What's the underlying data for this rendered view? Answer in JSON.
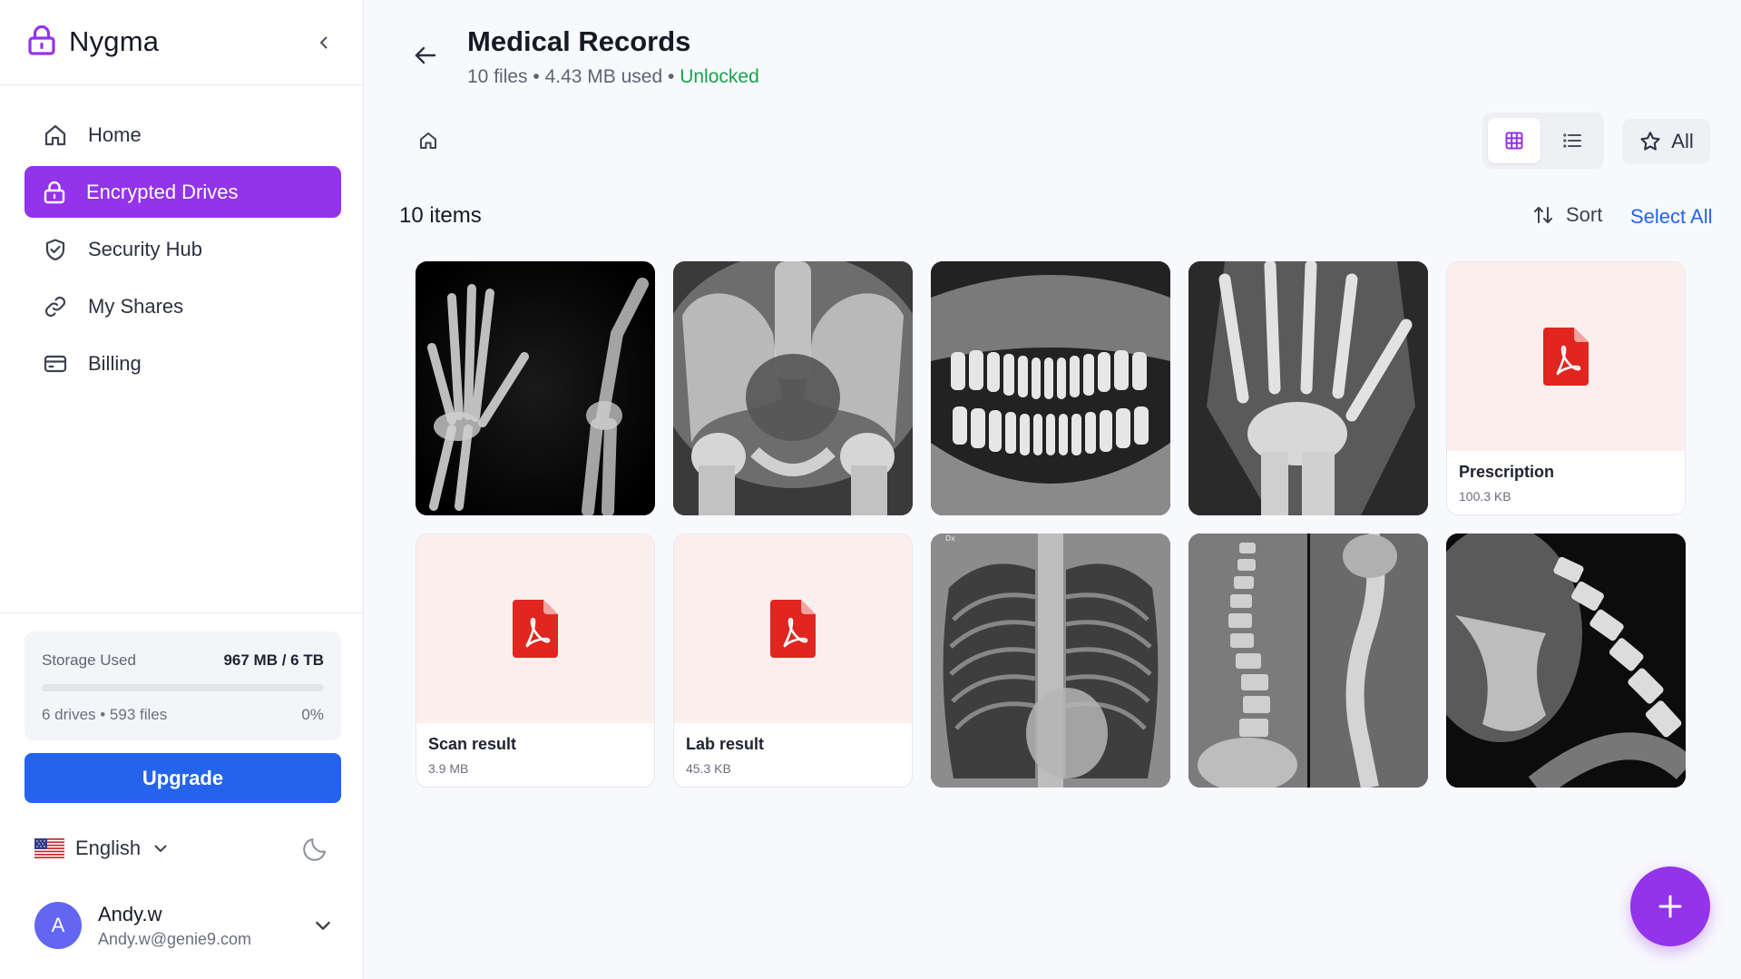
{
  "app": {
    "name": "Nygma",
    "logo_icon": "lock-icon",
    "accent": "#9333ea",
    "link_color": "#2563eb",
    "unlocked_color": "#16a34a"
  },
  "sidebar": {
    "items": [
      {
        "label": "Home",
        "icon": "home-icon",
        "active": false
      },
      {
        "label": "Encrypted Drives",
        "icon": "lock-icon",
        "active": true
      },
      {
        "label": "Security Hub",
        "icon": "shield-check-icon",
        "active": false
      },
      {
        "label": "My Shares",
        "icon": "link-icon",
        "active": false
      },
      {
        "label": "Billing",
        "icon": "credit-card-icon",
        "active": false
      }
    ],
    "storage": {
      "label": "Storage Used",
      "value": "967 MB / 6 TB",
      "meta": "6 drives • 593 files",
      "percent_label": "0%",
      "percent": 0
    },
    "upgrade_label": "Upgrade",
    "language": {
      "label": "English",
      "flag": "us-flag-icon"
    },
    "theme_icon": "moon-icon",
    "user": {
      "initial": "A",
      "name": "Andy.w",
      "email": "Andy.w@genie9.com",
      "avatar_color": "#6366f1"
    }
  },
  "header": {
    "title": "Medical Records",
    "subtitle_files": "10 files",
    "subtitle_used": "4.43 MB used",
    "subtitle_sep": " • ",
    "status": "Unlocked"
  },
  "toolbar": {
    "view": "grid",
    "filter_label": "All",
    "items_count": "10 items",
    "sort_label": "Sort",
    "select_all_label": "Select All"
  },
  "files": [
    {
      "type": "image",
      "name": "hand-xray-pair",
      "caption": ""
    },
    {
      "type": "image",
      "name": "pelvis-xray",
      "caption": ""
    },
    {
      "type": "image",
      "name": "dental-panoramic-xray",
      "caption": ""
    },
    {
      "type": "image",
      "name": "hand-xray",
      "caption": ""
    },
    {
      "type": "pdf",
      "name": "Prescription",
      "size": "100.3 KB"
    },
    {
      "type": "pdf",
      "name": "Scan result",
      "size": "3.9 MB"
    },
    {
      "type": "pdf",
      "name": "Lab result",
      "size": "45.3 KB"
    },
    {
      "type": "image",
      "name": "chest-xray",
      "caption": "Dx"
    },
    {
      "type": "image",
      "name": "spine-xray-pair",
      "caption": ""
    },
    {
      "type": "image",
      "name": "cervical-spine-xray",
      "caption": ""
    }
  ]
}
